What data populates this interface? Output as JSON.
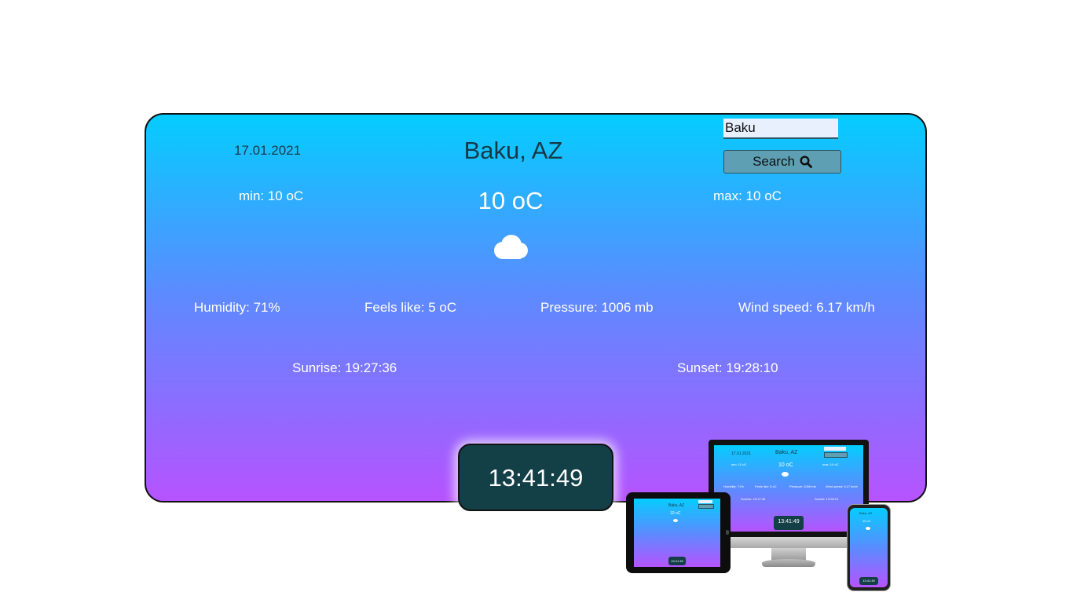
{
  "weather": {
    "date": "17.01.2021",
    "city": "Baku, AZ",
    "min": "min: 10 oC",
    "max": "max: 10 oC",
    "temp": "10 oC",
    "icon": "cloud-icon",
    "humidity": "Humidity: 71%",
    "feels_like": "Feels like: 5 oC",
    "pressure": "Pressure: 1006 mb",
    "wind": "Wind speed: 6.17 km/h",
    "sunrise": "Sunrise: 19:27:36",
    "sunset": "Sunset: 19:28:10"
  },
  "search": {
    "value": "Baku",
    "button_label": "Search",
    "button_icon": "search-icon"
  },
  "clock": {
    "time": "13:41:49"
  },
  "mockups": {
    "monitor": {
      "date": "17.01.2021",
      "city": "Baku, AZ",
      "search_value": "Baku",
      "search_label": "Search",
      "min": "min: 10 oC",
      "temp": "10 oC",
      "max": "max: 10 oC",
      "humidity": "Humidity: 71%",
      "feels": "Feels like: 5 oC",
      "pressure": "Pressure: 1006 mb",
      "wind": "Wind speed: 6.17 km/h",
      "sunrise": "Sunrise: 19:27:36",
      "sunset": "Sunset: 19:28:10",
      "clock": "13:41:49"
    },
    "tablet": {
      "city": "Baku, AZ",
      "temp": "10 oC",
      "clock": "13:41:49"
    },
    "phone": {
      "city": "Baku, AZ",
      "temp": "10 oC",
      "clock": "13:41:49"
    }
  },
  "colors": {
    "gradient_top": "#04cdff",
    "gradient_bottom": "#b653ff",
    "clock_bg": "#133f47",
    "button_bg": "#5e9fb3"
  }
}
